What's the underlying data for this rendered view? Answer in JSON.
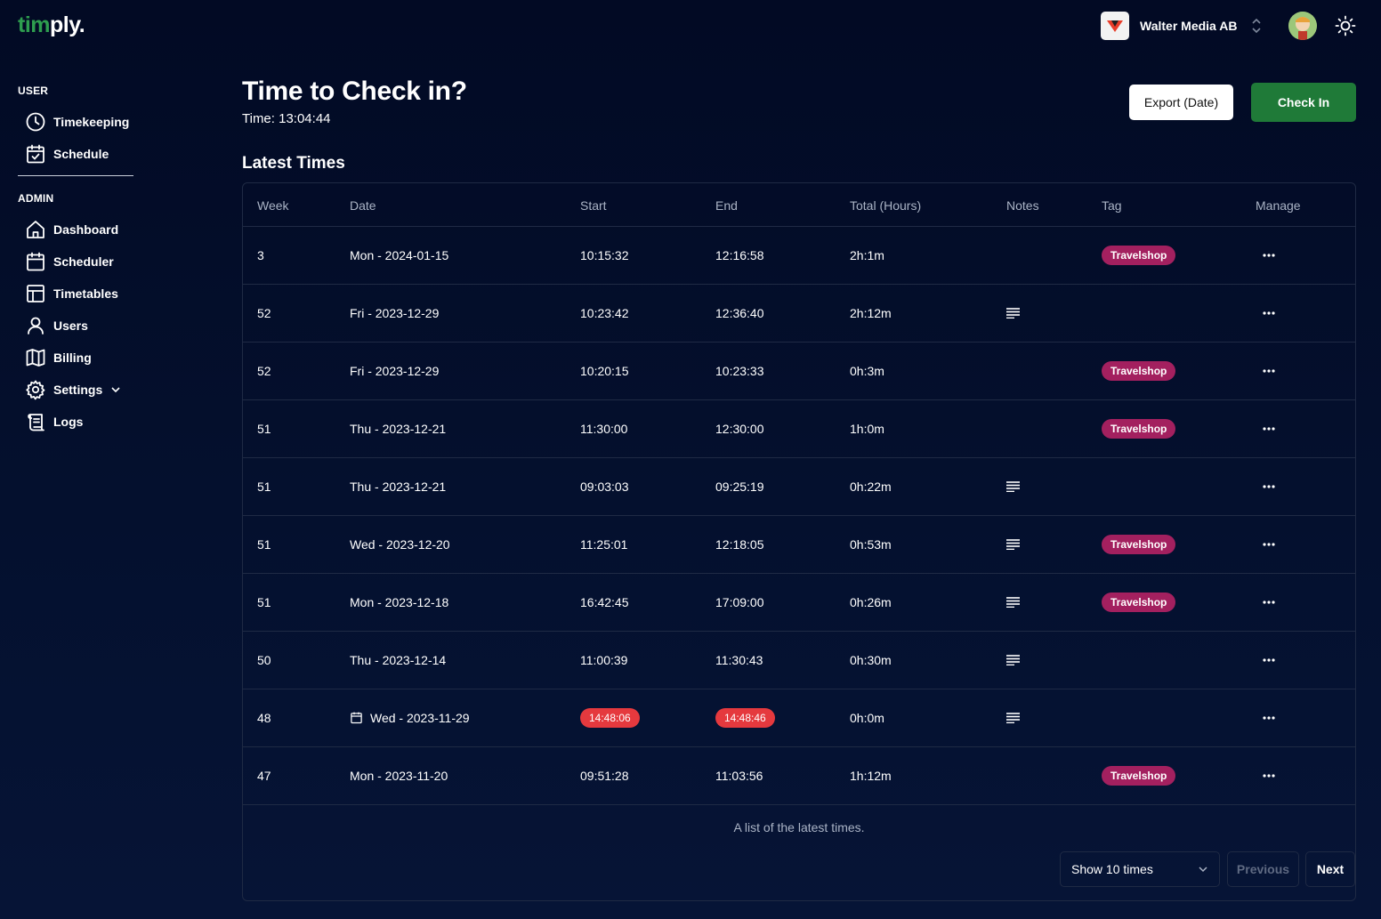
{
  "app": {
    "logo_part1": "tim",
    "logo_part2": "ply."
  },
  "org": {
    "name": "Walter Media AB"
  },
  "sidebar": {
    "user_heading": "USER",
    "admin_heading": "ADMIN",
    "user_items": [
      {
        "label": "Timekeeping",
        "icon": "clock-icon"
      },
      {
        "label": "Schedule",
        "icon": "calendar-check-icon"
      }
    ],
    "admin_items": [
      {
        "label": "Dashboard",
        "icon": "home-icon"
      },
      {
        "label": "Scheduler",
        "icon": "calendar-icon"
      },
      {
        "label": "Timetables",
        "icon": "table-icon"
      },
      {
        "label": "Users",
        "icon": "user-icon"
      },
      {
        "label": "Billing",
        "icon": "map-icon"
      },
      {
        "label": "Settings",
        "icon": "gear-icon"
      },
      {
        "label": "Logs",
        "icon": "scroll-icon"
      }
    ]
  },
  "header": {
    "title": "Time to Check in?",
    "time": "Time: 13:04:44",
    "export_label": "Export (Date)",
    "checkin_label": "Check In"
  },
  "table": {
    "heading": "Latest Times",
    "columns": [
      "Week",
      "Date",
      "Start",
      "End",
      "Total (Hours)",
      "Notes",
      "Tag",
      "Manage"
    ],
    "rows": [
      {
        "week": "3",
        "date": "Mon - 2024-01-15",
        "start": "10:15:32",
        "end": "12:16:58",
        "total": "2h:1m",
        "notes": false,
        "tag": "Travelshop",
        "flag": false
      },
      {
        "week": "52",
        "date": "Fri - 2023-12-29",
        "start": "10:23:42",
        "end": "12:36:40",
        "total": "2h:12m",
        "notes": true,
        "tag": "",
        "flag": false
      },
      {
        "week": "52",
        "date": "Fri - 2023-12-29",
        "start": "10:20:15",
        "end": "10:23:33",
        "total": "0h:3m",
        "notes": false,
        "tag": "Travelshop",
        "flag": false
      },
      {
        "week": "51",
        "date": "Thu - 2023-12-21",
        "start": "11:30:00",
        "end": "12:30:00",
        "total": "1h:0m",
        "notes": false,
        "tag": "Travelshop",
        "flag": false
      },
      {
        "week": "51",
        "date": "Thu - 2023-12-21",
        "start": "09:03:03",
        "end": "09:25:19",
        "total": "0h:22m",
        "notes": true,
        "tag": "",
        "flag": false
      },
      {
        "week": "51",
        "date": "Wed - 2023-12-20",
        "start": "11:25:01",
        "end": "12:18:05",
        "total": "0h:53m",
        "notes": true,
        "tag": "Travelshop",
        "flag": false
      },
      {
        "week": "51",
        "date": "Mon - 2023-12-18",
        "start": "16:42:45",
        "end": "17:09:00",
        "total": "0h:26m",
        "notes": true,
        "tag": "Travelshop",
        "flag": false
      },
      {
        "week": "50",
        "date": "Thu - 2023-12-14",
        "start": "11:00:39",
        "end": "11:30:43",
        "total": "0h:30m",
        "notes": true,
        "tag": "",
        "flag": false
      },
      {
        "week": "48",
        "date": "Wed - 2023-11-29",
        "start": "14:48:06",
        "end": "14:48:46",
        "total": "0h:0m",
        "notes": true,
        "tag": "",
        "flag": true
      },
      {
        "week": "47",
        "date": "Mon - 2023-11-20",
        "start": "09:51:28",
        "end": "11:03:56",
        "total": "1h:12m",
        "notes": false,
        "tag": "Travelshop",
        "flag": false
      }
    ],
    "caption": "A list of the latest times.",
    "page_size_label": "Show 10 times",
    "previous_label": "Previous",
    "next_label": "Next"
  },
  "colors": {
    "background": "#020a24",
    "accent_green": "#1f7a38",
    "tag_magenta": "#a3205f",
    "alert_red": "#e5393e"
  }
}
